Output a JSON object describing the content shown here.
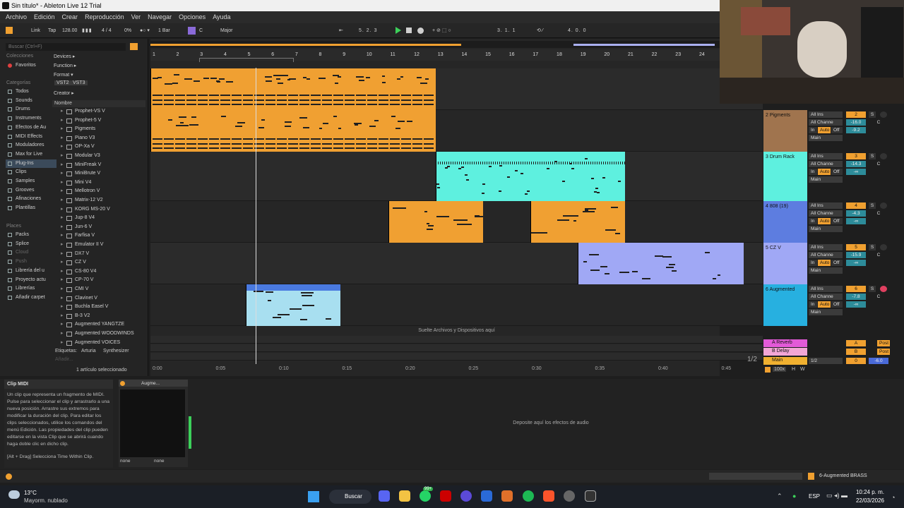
{
  "window": {
    "title": "Sin título* - Ableton Live 12 Trial",
    "min": "—",
    "max": "☐",
    "close": "✕"
  },
  "menu": [
    "Archivo",
    "Edición",
    "Crear",
    "Reproducción",
    "Ver",
    "Navegar",
    "Opciones",
    "Ayuda"
  ],
  "control_bar": {
    "link": "Link",
    "tap": "Tap",
    "tempo": "128.00",
    "meter": "4 / 4",
    "cpu": "0%",
    "quantize": "1 Bar",
    "key": "C",
    "scale": "Major",
    "position": "5.  2.  3",
    "loop_start": "3.  1.  1",
    "loop_len": "4.  0.  0"
  },
  "browser": {
    "search_placeholder": "Buscar (Ctrl+F)",
    "collections_label": "Colecciones",
    "favorites": "Favoritos",
    "categories_label": "Categorías",
    "categories": [
      "Todos",
      "Sounds",
      "Drums",
      "Instruments",
      "Efectos de Au",
      "MIDI Effects",
      "Moduladores",
      "Max for Live",
      "Plug-Ins",
      "Clips",
      "Samples",
      "Grooves",
      "Afinaciones",
      "Plantillas"
    ],
    "places_label": "Places",
    "places": [
      "Packs",
      "Splice",
      "Cloud",
      "Push",
      "Librería del u",
      "Proyecto actu",
      "Librerías",
      "Añadir carpet"
    ],
    "filters": [
      "Devices ▸",
      "Function ▸",
      "Format ▾",
      "Creator ▸"
    ],
    "format_tags": [
      "VST2",
      "VST3"
    ],
    "name_header": "Nombre",
    "plugins": [
      "Prophet-VS V",
      "Prophet-5 V",
      "Pigments",
      "Piano V3",
      "OP-Xa V",
      "Modular V3",
      "MiniFreak V",
      "MiniBrute V",
      "Mini V4",
      "Mellotron V",
      "Matrix-12 V2",
      "KORG MS-20 V",
      "Jup-8 V4",
      "Jun-6 V",
      "Farfisa V",
      "Emulator II V",
      "DX7 V",
      "CZ V",
      "CS-80 V4",
      "CP-70 V",
      "CMI V",
      "Clavinet V",
      "Buchla Easel V",
      "B-3 V2",
      "Augmented YANGTZE",
      "Augmented WOODWINDS",
      "Augmented VOICES"
    ],
    "tags_label": "Etiquetas:",
    "tags": [
      "Arturia",
      "Synthesizer"
    ],
    "add_placeholder": "Añadir...",
    "selection_status": "1 artículo seleccionado"
  },
  "arrangement": {
    "bars": [
      "1",
      "2",
      "3",
      "4",
      "5",
      "6",
      "7",
      "8",
      "9",
      "10",
      "11",
      "12",
      "13",
      "14",
      "15",
      "16",
      "17",
      "18",
      "19",
      "20",
      "21",
      "22",
      "23",
      "24"
    ],
    "times": [
      "0:00",
      "0:05",
      "0:10",
      "0:15",
      "0:20",
      "0:25",
      "0:30",
      "0:35",
      "0:40",
      "0:45"
    ],
    "drop_hint": "Suelte Archivos y Dispositivos aquí",
    "zoom": "1/2"
  },
  "tracks": [
    {
      "name": "2 Pigments",
      "color": "#a0744e",
      "in": "All Ins",
      "ch": "All Channe",
      "num": "2",
      "vol": "-16.0",
      "pan": "C",
      "send": "-9.2"
    },
    {
      "name": "3 Drum Rack",
      "color": "#5ef0df",
      "in": "All Ins",
      "ch": "All Channe",
      "num": "3",
      "vol": "-14.3",
      "pan": "C",
      "send": "-∞"
    },
    {
      "name": "4 808 (19)",
      "color": "#5d7de0",
      "in": "All Ins",
      "ch": "All Channe",
      "num": "4",
      "vol": "-4.3",
      "pan": "C",
      "send": "-∞"
    },
    {
      "name": "5 CZ V",
      "color": "#a0a8f5",
      "in": "All Ins",
      "ch": "All Channe",
      "num": "5",
      "vol": "-15.9",
      "pan": "C",
      "send": "-∞"
    },
    {
      "name": "6 Augmented",
      "color": "#27b0e0",
      "in": "All Ins",
      "ch": "All Channe",
      "num": "6",
      "vol": "-7.8",
      "pan": "C",
      "send": "-∞"
    }
  ],
  "monitor": {
    "in": "In",
    "auto": "Auto",
    "off": "Off",
    "out": "Main",
    "solo": "S"
  },
  "returns": [
    {
      "name": "A Reverb",
      "color": "#e35ad8",
      "num": "A",
      "post": "Post"
    },
    {
      "name": "B Delay",
      "color": "#f3a6d6",
      "num": "B",
      "post": "Post"
    },
    {
      "name": "Main",
      "color": "#f0b030",
      "num": "0",
      "vol": "-6.0",
      "sel": "1/2"
    }
  ],
  "master_bar": {
    "zoom": "100x",
    "h": "H",
    "w": "W"
  },
  "info": {
    "title": "Clip MIDI",
    "body": "Un clip que representa un fragmento de MIDI. Pulse para seleccionar el clip y arrastrarlo a una nueva posición. Arrastre sus extremos para modificar la duración del clip. Para editar los clips seleccionados, utilice los comandos del menú Edición. Las propiedades del clip pueden editarse en la vista Clip que se abrirá cuando haga doble clic en dicho clip.",
    "hint": "[Alt + Drag] Selecciona Time Within Clip."
  },
  "device": {
    "name": "Augme...",
    "chain1": "none",
    "chain2": "none"
  },
  "audio_drop": "Deposite aquí los efectos de audio",
  "status": {
    "track": "6-Augmented BRASS"
  },
  "taskbar": {
    "temp": "13°C",
    "weather": "Mayorm. nublado",
    "search": "Buscar",
    "lang": "ESP",
    "time": "10:24 p. m.",
    "date": "22/03/2026",
    "badge": "99+"
  }
}
